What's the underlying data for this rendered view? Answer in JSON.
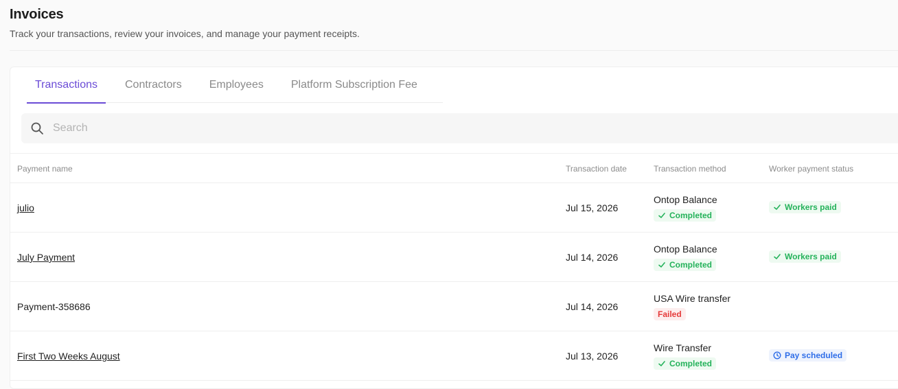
{
  "header": {
    "title": "Invoices",
    "subtitle": "Track your transactions, review your invoices, and manage your payment receipts."
  },
  "tabs": [
    {
      "label": "Transactions",
      "active": true
    },
    {
      "label": "Contractors",
      "active": false
    },
    {
      "label": "Employees",
      "active": false
    },
    {
      "label": "Platform Subscription Fee",
      "active": false
    }
  ],
  "search": {
    "placeholder": "Search",
    "value": ""
  },
  "table": {
    "columns": [
      "Payment name",
      "Transaction date",
      "Transaction method",
      "Worker payment status"
    ],
    "rows": [
      {
        "name": "julio",
        "date": "Jul 15, 2026",
        "method": "Ontop Balance",
        "method_status": "Completed",
        "worker_status": "Workers paid"
      },
      {
        "name": "July Payment",
        "date": "Jul 14, 2026",
        "method": "Ontop Balance",
        "method_status": "Completed",
        "worker_status": "Workers paid"
      },
      {
        "name": "Payment-358686",
        "date": "Jul 14, 2026",
        "method": "USA Wire transfer",
        "method_status": "Failed",
        "worker_status": ""
      },
      {
        "name": "First Two Weeks August",
        "date": "Jul 13, 2026",
        "method": "Wire Transfer",
        "method_status": "Completed",
        "worker_status": "Pay scheduled"
      }
    ]
  },
  "colors": {
    "accent": "#6a4bd6",
    "success": "#24b25a",
    "error": "#e53a3a",
    "info": "#2f6ee8"
  }
}
